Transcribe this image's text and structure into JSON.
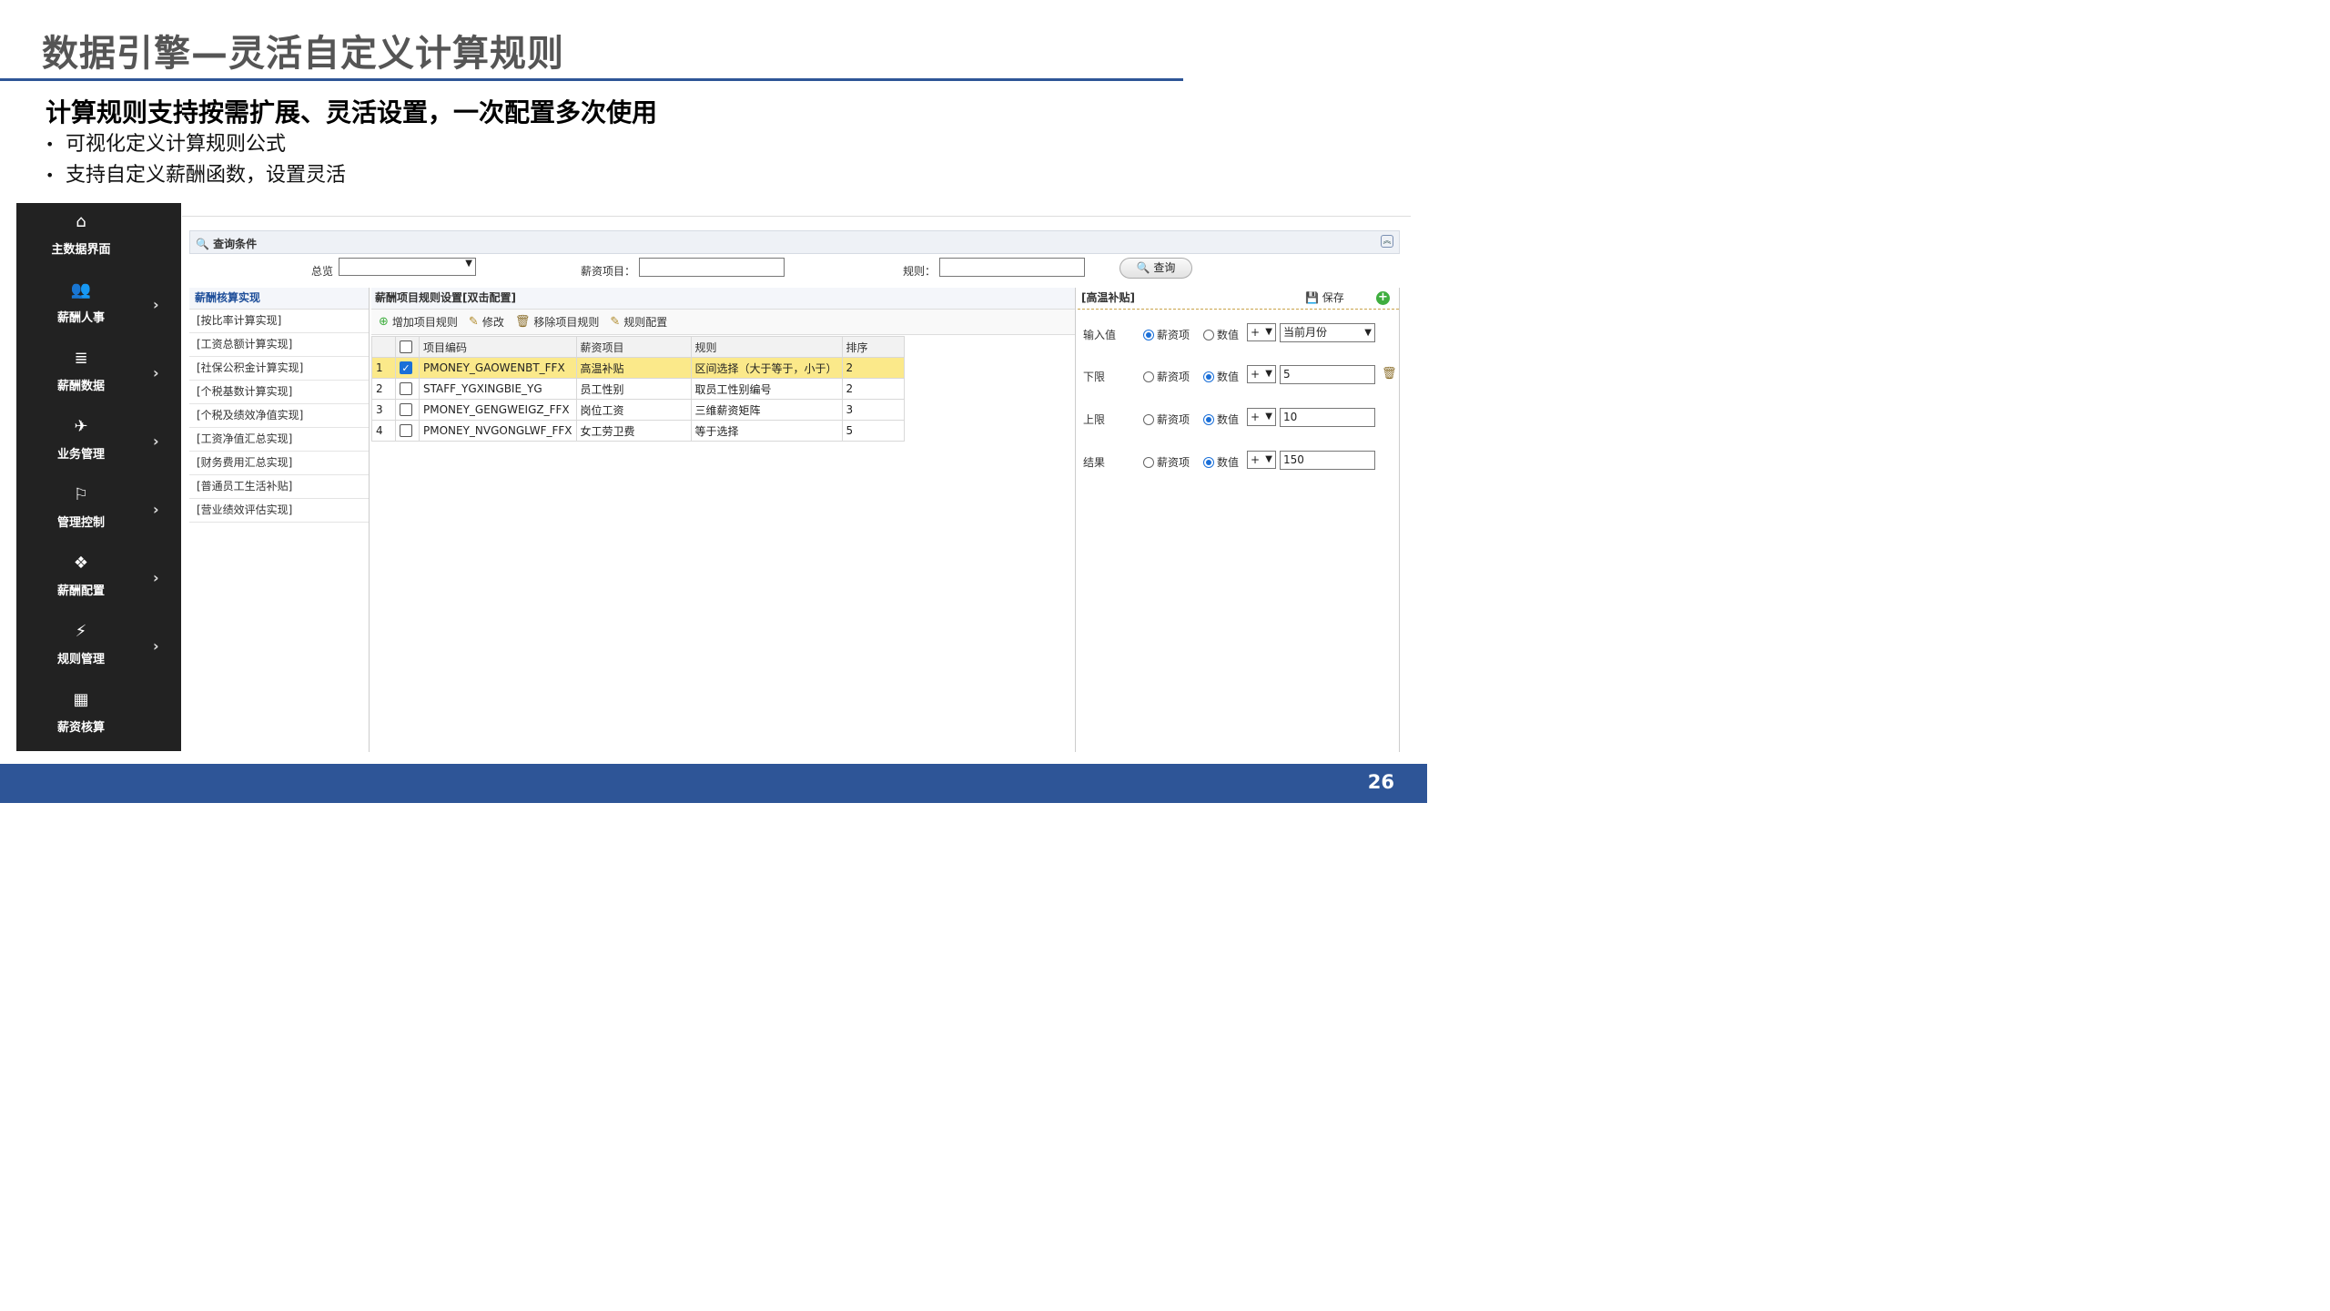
{
  "slide": {
    "title": "数据引擎—灵活自定义计算规则",
    "subtitle": "计算规则支持按需扩展、灵活设置，一次配置多次使用",
    "bullets": [
      "可视化定义计算规则公式",
      "支持自定义薪酬函数，设置灵活"
    ],
    "page_number": "26"
  },
  "colors": {
    "accent": "#2e5597",
    "sidebar": "#222222",
    "selected_row": "#fbe98a"
  },
  "sidebar": {
    "items": [
      {
        "label": "主数据界面",
        "icon": "home-icon",
        "glyph": "⌂",
        "has_arrow": false
      },
      {
        "label": "薪酬人事",
        "icon": "users-icon",
        "glyph": "👥",
        "has_arrow": true
      },
      {
        "label": "薪酬数据",
        "icon": "database-icon",
        "glyph": "≣",
        "has_arrow": true
      },
      {
        "label": "业务管理",
        "icon": "plane-icon",
        "glyph": "✈",
        "has_arrow": true
      },
      {
        "label": "管理控制",
        "icon": "flag-icon",
        "glyph": "⚐",
        "has_arrow": true
      },
      {
        "label": "薪酬配置",
        "icon": "cubes-icon",
        "glyph": "❖",
        "has_arrow": true
      },
      {
        "label": "规则管理",
        "icon": "plug-icon",
        "glyph": "⚡",
        "has_arrow": true
      },
      {
        "label": "薪资核算",
        "icon": "calculator-icon",
        "glyph": "▦",
        "has_arrow": false
      }
    ],
    "arrow": "›"
  },
  "query": {
    "title": "查询条件",
    "collapse": "︽",
    "overview_label": "总览",
    "overview_value": "",
    "item_label": "薪资项目：",
    "item_value": "",
    "rule_label": "规则：",
    "rule_value": "",
    "search_button": "查询"
  },
  "left_panel": {
    "header": "薪酬核算实现",
    "items": [
      "[按比率计算实现]",
      "[工资总额计算实现]",
      "[社保公积金计算实现]",
      "[个税基数计算实现]",
      "[个税及绩效净值实现]",
      "[工资净值汇总实现]",
      "[财务费用汇总实现]",
      "[普通员工生活补贴]",
      "[营业绩效评估实现]"
    ]
  },
  "center_panel": {
    "header": "薪酬项目规则设置[双击配置]",
    "toolbar": {
      "add": "增加项目规则",
      "edit": "修改",
      "remove": "移除项目规则",
      "config": "规则配置"
    },
    "columns": [
      "项目编码",
      "薪资项目",
      "规则",
      "排序"
    ],
    "rows": [
      {
        "num": "1",
        "checked": true,
        "code": "PMONEY_GAOWENBT_FFX",
        "item": "高温补贴",
        "rule": "区间选择（大于等于，小于）",
        "order": "2"
      },
      {
        "num": "2",
        "checked": false,
        "code": "STAFF_YGXINGBIE_YG",
        "item": "员工性别",
        "rule": "取员工性别编号",
        "order": "2"
      },
      {
        "num": "3",
        "checked": false,
        "code": "PMONEY_GENGWEIGZ_FFX",
        "item": "岗位工资",
        "rule": "三维薪资矩阵",
        "order": "3"
      },
      {
        "num": "4",
        "checked": false,
        "code": "PMONEY_NVGONGLWF_FFX",
        "item": "女工劳卫费",
        "rule": "等于选择",
        "order": "5"
      }
    ]
  },
  "right_panel": {
    "header": "[高温补贴]",
    "save": "保存",
    "opt_item": "薪资项",
    "opt_value": "数值",
    "rows": [
      {
        "label": "输入值",
        "selected": "item",
        "op": "+",
        "value": "当前月份",
        "is_select": true,
        "trash": false
      },
      {
        "label": "下限",
        "selected": "value",
        "op": "+",
        "value": "5",
        "is_select": false,
        "trash": true
      },
      {
        "label": "上限",
        "selected": "value",
        "op": "+",
        "value": "10",
        "is_select": false,
        "trash": false
      },
      {
        "label": "结果",
        "selected": "value",
        "op": "+",
        "value": "150",
        "is_select": false,
        "trash": false
      }
    ]
  }
}
